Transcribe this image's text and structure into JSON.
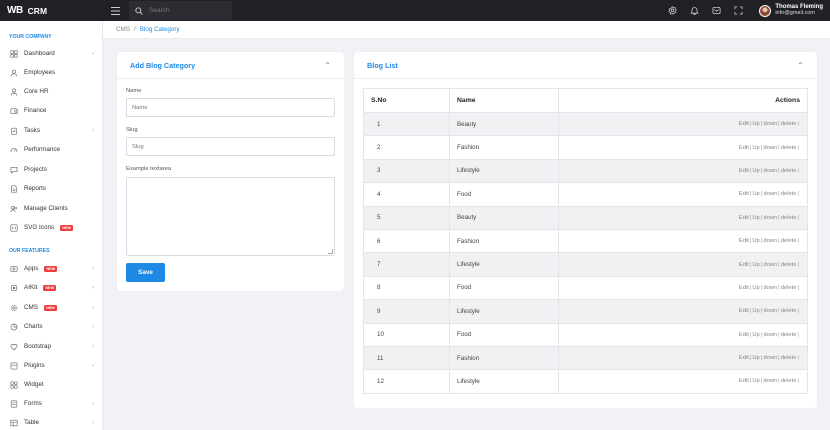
{
  "app": {
    "logo": "WB",
    "name": "CRM"
  },
  "search": {
    "placeholder": "Search"
  },
  "user": {
    "name": "Thomas Fleming",
    "email": "info@gmail.com"
  },
  "sidebar": {
    "section1": "YOUR COMPANY",
    "section2": "OUR FEATURES",
    "items": [
      {
        "label": "Dashboard",
        "icon": "grid-icon",
        "chevron": true
      },
      {
        "label": "Employees",
        "icon": "user-icon",
        "chevron": false
      },
      {
        "label": "Core HR",
        "icon": "user-tie-icon",
        "chevron": false
      },
      {
        "label": "Finance",
        "icon": "wallet-icon",
        "chevron": false
      },
      {
        "label": "Tasks",
        "icon": "clipboard-icon",
        "chevron": true
      },
      {
        "label": "Performance",
        "icon": "speedometer-icon",
        "chevron": false
      },
      {
        "label": "Projects",
        "icon": "chat-icon",
        "chevron": false
      },
      {
        "label": "Reports",
        "icon": "document-icon",
        "chevron": false
      },
      {
        "label": "Manage Clients",
        "icon": "clients-icon",
        "chevron": false
      },
      {
        "label": "SVG Icons",
        "icon": "code-icon",
        "chevron": false,
        "badge": "NEW"
      },
      {
        "label": "Apps",
        "icon": "apps-icon",
        "chevron": true,
        "badge": "NEW"
      },
      {
        "label": "AIKit",
        "icon": "chip-icon",
        "chevron": true,
        "badge": "NEW"
      },
      {
        "label": "CMS",
        "icon": "settings-icon",
        "chevron": true,
        "badge": "NEW"
      },
      {
        "label": "Charts",
        "icon": "chart-icon",
        "chevron": true
      },
      {
        "label": "Bootstrap",
        "icon": "heart-icon",
        "chevron": true
      },
      {
        "label": "Plugins",
        "icon": "plugin-icon",
        "chevron": true
      },
      {
        "label": "Widget",
        "icon": "widget-icon",
        "chevron": false
      },
      {
        "label": "Forms",
        "icon": "form-icon",
        "chevron": true
      },
      {
        "label": "Table",
        "icon": "table-icon",
        "chevron": true
      }
    ]
  },
  "breadcrumb": {
    "root": "CMS",
    "separator": "/",
    "current": "Blog Category"
  },
  "addForm": {
    "title": "Add Blog Category",
    "nameLabel": "Name",
    "namePlaceholder": "Name",
    "slugLabel": "Slug",
    "slugPlaceholder": "Slug",
    "textareaLabel": "Example textarea",
    "saveLabel": "Save"
  },
  "blogList": {
    "title": "Blog List",
    "columns": {
      "sno": "S.No",
      "name": "Name",
      "actions": "Actions"
    },
    "actions": [
      "Edit",
      "Up",
      "down",
      "delete"
    ],
    "rows": [
      {
        "sno": "1",
        "name": "Beauty"
      },
      {
        "sno": "2",
        "name": "Fashion"
      },
      {
        "sno": "3",
        "name": "Lifestyle"
      },
      {
        "sno": "4",
        "name": "Food"
      },
      {
        "sno": "5",
        "name": "Beauty"
      },
      {
        "sno": "6",
        "name": "Fashion"
      },
      {
        "sno": "7",
        "name": "Lifestyle"
      },
      {
        "sno": "8",
        "name": "Food"
      },
      {
        "sno": "9",
        "name": "Lifestyle"
      },
      {
        "sno": "10",
        "name": "Food"
      },
      {
        "sno": "11",
        "name": "Fashion"
      },
      {
        "sno": "12",
        "name": "Lifestyle"
      }
    ]
  },
  "colors": {
    "accent": "#1e88e5",
    "topbar": "#1f2125",
    "badge": "#ee3b3b"
  }
}
